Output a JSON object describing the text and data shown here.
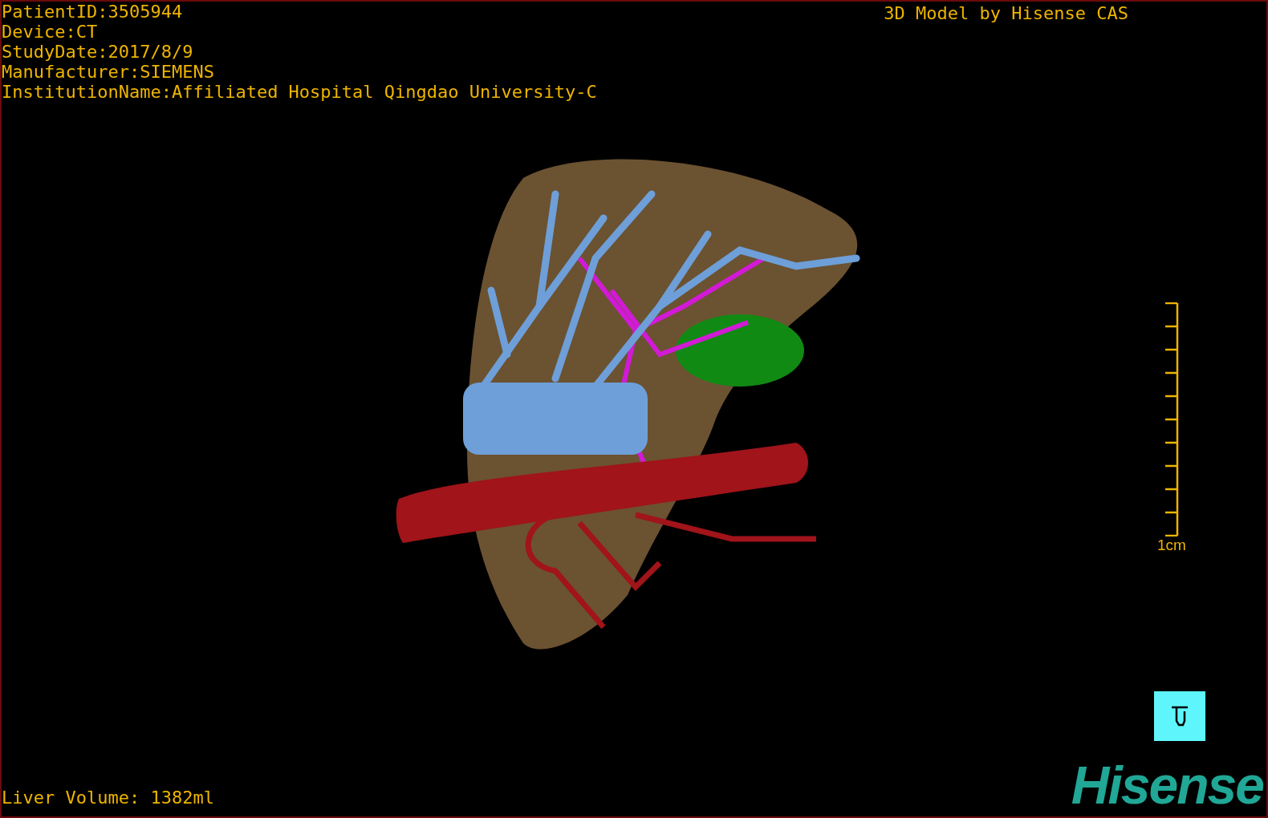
{
  "patient_info": [
    "PatientID:3505944",
    "Device:CT",
    "StudyDate:2017/8/9",
    "Manufacturer:SIEMENS",
    "InstitutionName:Affiliated Hospital Qingdao University-C"
  ],
  "model_title": "3D Model by Hisense CAS",
  "scale_bar": {
    "label": "1cm"
  },
  "liver_volume": "Liver Volume: 1382ml",
  "logo": "Hisense"
}
